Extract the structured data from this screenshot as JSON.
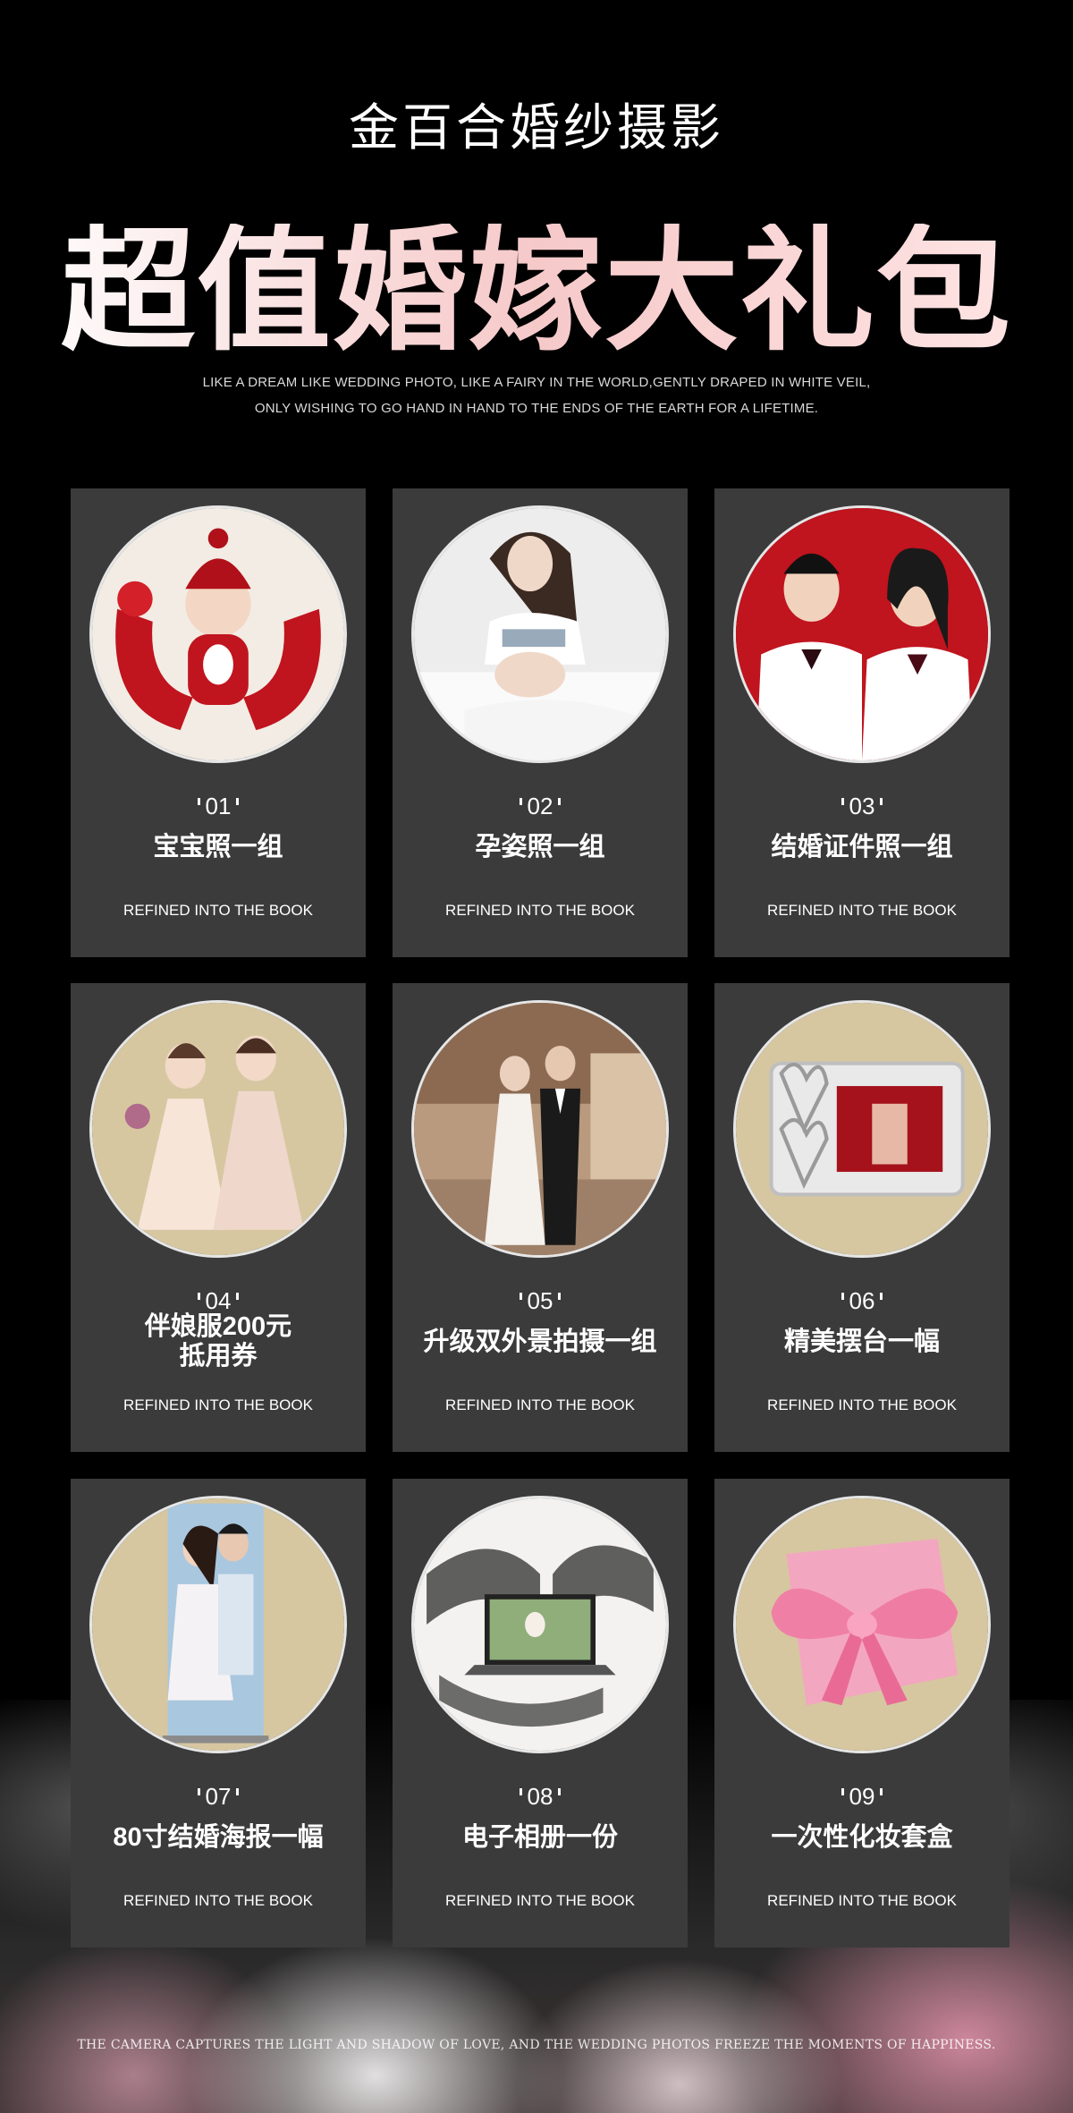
{
  "header": {
    "brand": "金百合婚纱摄影",
    "headline": "超值婚嫁大礼包",
    "tagline_line1": "LIKE A DREAM LIKE WEDDING PHOTO, LIKE A FAIRY IN THE WORLD,GENTLY DRAPED IN WHITE VEIL,",
    "tagline_line2": "ONLY WISHING TO GO HAND IN HAND TO THE ENDS OF THE EARTH FOR A LIFETIME."
  },
  "cards": [
    {
      "num": "01",
      "title": "宝宝照一组",
      "sub": "REFINED INTO THE BOOK",
      "image": "baby-photo"
    },
    {
      "num": "02",
      "title": "孕姿照一组",
      "sub": "REFINED INTO THE BOOK",
      "image": "maternity-photo"
    },
    {
      "num": "03",
      "title": "结婚证件照一组",
      "sub": "REFINED INTO THE BOOK",
      "image": "id-photo"
    },
    {
      "num": "04",
      "title": "伴娘服200元\n抵用券",
      "sub": "REFINED INTO THE BOOK",
      "image": "bridesmaid-dress"
    },
    {
      "num": "05",
      "title": "升级双外景拍摄一组",
      "sub": "REFINED INTO THE BOOK",
      "image": "outdoor-shoot"
    },
    {
      "num": "06",
      "title": "精美摆台一幅",
      "sub": "REFINED INTO THE BOOK",
      "image": "photo-frame"
    },
    {
      "num": "07",
      "title": "80寸结婚海报一幅",
      "sub": "REFINED INTO THE BOOK",
      "image": "roll-up-poster"
    },
    {
      "num": "08",
      "title": "电子相册一份",
      "sub": "REFINED INTO THE BOOK",
      "image": "digital-album"
    },
    {
      "num": "09",
      "title": "一次性化妆套盒",
      "sub": "REFINED INTO THE BOOK",
      "image": "gift-box"
    }
  ],
  "footer": {
    "text": "THE CAMERA CAPTURES THE LIGHT AND SHADOW OF LOVE, AND THE WEDDING PHOTOS FREEZE THE MOMENTS OF HAPPINESS."
  },
  "colors": {
    "card_bg": "#3b3b3b",
    "circle_beige": "#d6c7a1",
    "accent_red": "#c0141e",
    "accent_pink": "#f0a9bf"
  }
}
